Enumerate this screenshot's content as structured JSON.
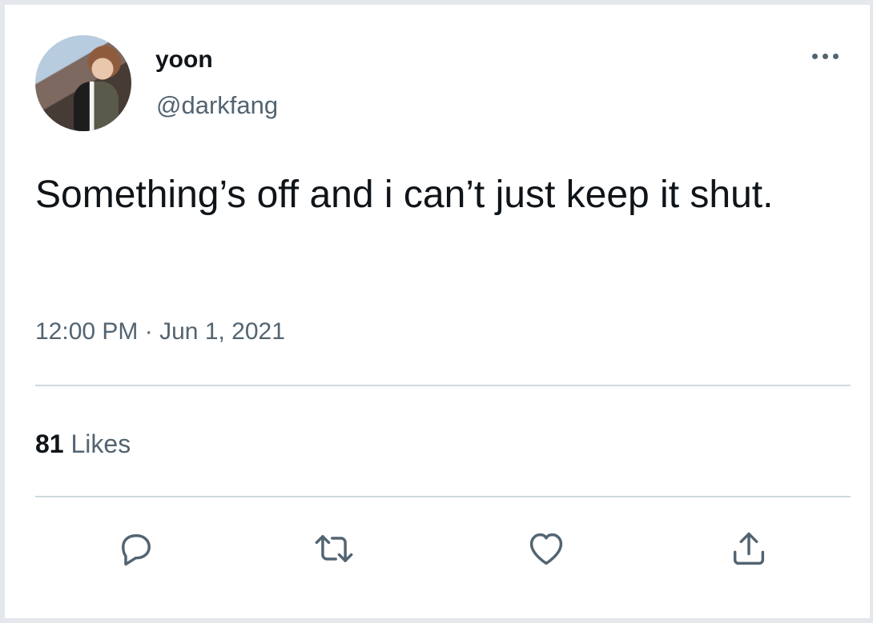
{
  "tweet": {
    "author": {
      "display_name": "yoon",
      "handle": "@darkfang"
    },
    "text": "Something’s off and i can’t just keep it shut.",
    "timestamp": {
      "time": "12:00 PM",
      "separator": "·",
      "date": "Jun 1, 2021"
    },
    "likes": {
      "count": "81",
      "label": "Likes"
    },
    "actions": [
      {
        "icon": "reply-icon"
      },
      {
        "icon": "retweet-icon"
      },
      {
        "icon": "heart-icon"
      },
      {
        "icon": "share-icon"
      }
    ]
  },
  "colors": {
    "text_primary": "#0f1419",
    "text_secondary": "#536471",
    "divider": "#cfd9de",
    "background": "#ffffff"
  }
}
